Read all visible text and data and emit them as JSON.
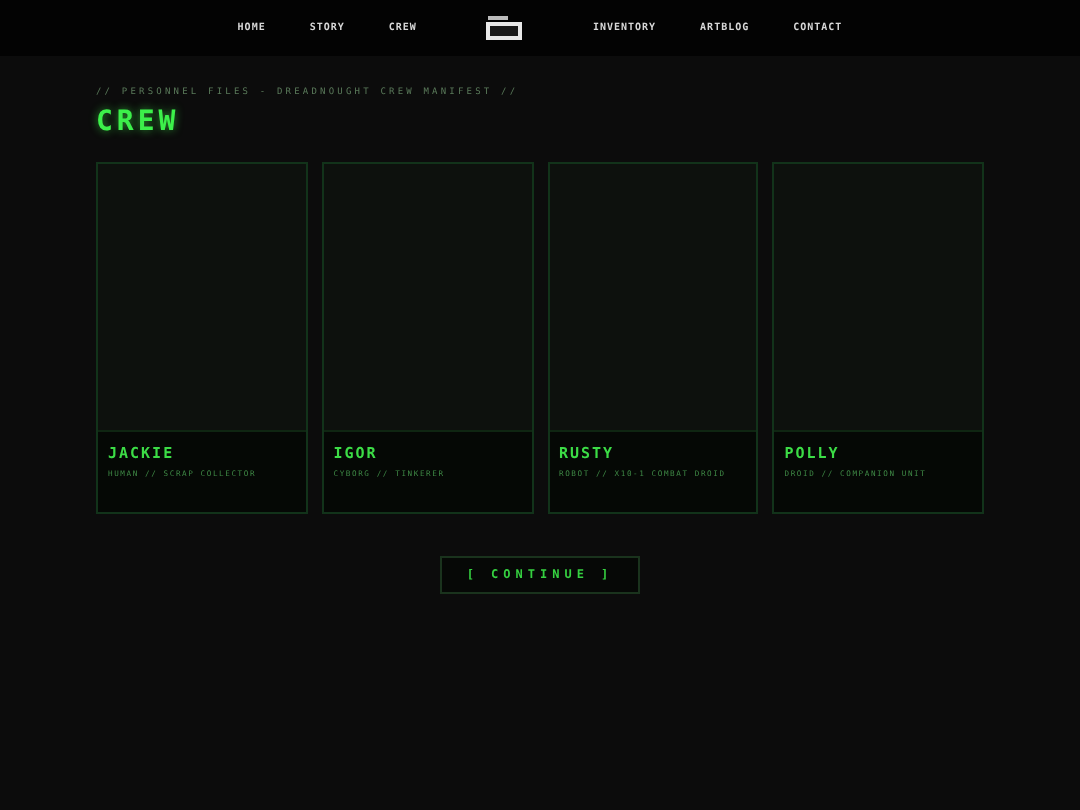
{
  "nav": {
    "left": [
      "HOME",
      "STORY",
      "CREW"
    ],
    "right": [
      "INVENTORY",
      "ARTBLOG",
      "CONTACT"
    ]
  },
  "breadcrumb": "// PERSONNEL FILES - DREADNOUGHT CREW MANIFEST //",
  "title": "CREW",
  "crew": [
    {
      "name": "JACKIE",
      "role": "HUMAN // SCRAP COLLECTOR"
    },
    {
      "name": "IGOR",
      "role": "CYBORG // TINKERER"
    },
    {
      "name": "RUSTY",
      "role": "ROBOT // X10-1 COMBAT DROID"
    },
    {
      "name": "POLLY",
      "role": "DROID // COMPANION UNIT"
    }
  ],
  "continue": "[ CONTINUE ]"
}
